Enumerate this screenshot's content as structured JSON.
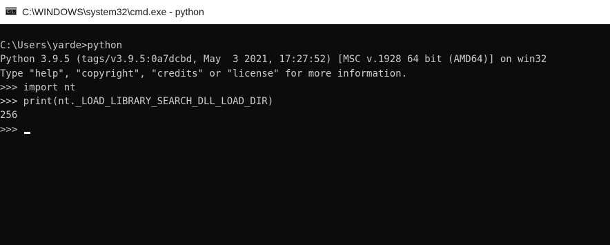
{
  "window": {
    "title": "C:\\WINDOWS\\system32\\cmd.exe - python",
    "icon": "cmd-icon",
    "icon_text": "C:\\."
  },
  "console": {
    "lines": [
      "C:\\Users\\yarde>python",
      "Python 3.9.5 (tags/v3.9.5:0a7dcbd, May  3 2021, 17:27:52) [MSC v.1928 64 bit (AMD64)] on win32",
      "Type \"help\", \"copyright\", \"credits\" or \"license\" for more information.",
      ">>> import nt",
      ">>> print(nt._LOAD_LIBRARY_SEARCH_DLL_LOAD_DIR)",
      "256",
      ">>> "
    ],
    "text_color": "#cccccc",
    "background_color": "#0c0c0c"
  }
}
